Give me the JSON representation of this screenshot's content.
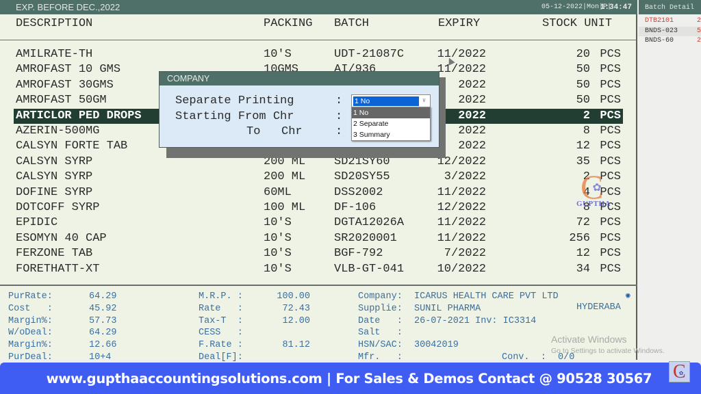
{
  "window": {
    "title": "EXP. BEFORE DEC.,2022",
    "datetime": "05-12-2022|Mon|P|",
    "clock": "1:34:47"
  },
  "columns": {
    "description": "DESCRIPTION",
    "packing": "PACKING",
    "batch": "BATCH",
    "expiry": "EXPIRY",
    "stock_unit": "STOCK UNIT"
  },
  "rows": [
    {
      "description": "AMILRATE-TH",
      "packing": "10'S",
      "batch": "UDT-21087C",
      "expiry": "11/2022",
      "stock": "20",
      "unit": "PCS"
    },
    {
      "description": "AMROFAST 10 GMS",
      "packing": "10GMS",
      "batch": "AI/936",
      "expiry": "11/2022",
      "stock": "50",
      "unit": "PCS"
    },
    {
      "description": "AMROFAST 30GMS",
      "packing": "",
      "batch": "",
      "expiry": "2022",
      "stock": "50",
      "unit": "PCS"
    },
    {
      "description": "AMROFAST 50GM",
      "packing": "",
      "batch": "",
      "expiry": "2022",
      "stock": "50",
      "unit": "PCS"
    },
    {
      "description": "ARTICLOR PED DROPS",
      "packing": "",
      "batch": "",
      "expiry": "2022",
      "stock": "2",
      "unit": "PCS",
      "selected": true
    },
    {
      "description": "AZERIN-500MG",
      "packing": "",
      "batch": "",
      "expiry": "2022",
      "stock": "8",
      "unit": "PCS"
    },
    {
      "description": "CALSYN FORTE TAB",
      "packing": "",
      "batch": "",
      "expiry": "2022",
      "stock": "12",
      "unit": "PCS"
    },
    {
      "description": "CALSYN SYRP",
      "packing": "200 ML",
      "batch": "SD21SY60",
      "expiry": "12/2022",
      "stock": "35",
      "unit": "PCS"
    },
    {
      "description": "CALSYN SYRP",
      "packing": "200 ML",
      "batch": "SD20SY55",
      "expiry": "3/2022",
      "stock": "2",
      "unit": "PCS"
    },
    {
      "description": "DOFINE SYRP",
      "packing": "60ML",
      "batch": "DSS2002",
      "expiry": "11/2022",
      "stock": "4",
      "unit": "PCS"
    },
    {
      "description": "DOTCOFF SYRP",
      "packing": "100 ML",
      "batch": "DF-106",
      "expiry": "12/2022",
      "stock": "8",
      "unit": "PCS"
    },
    {
      "description": "EPIDIC",
      "packing": "10'S",
      "batch": "DGTA12026A",
      "expiry": "11/2022",
      "stock": "72",
      "unit": "PCS"
    },
    {
      "description": "ESOMYN 40 CAP",
      "packing": "10'S",
      "batch": "SR2020001",
      "expiry": "11/2022",
      "stock": "256",
      "unit": "PCS"
    },
    {
      "description": "FERZONE TAB",
      "packing": "10'S",
      "batch": "BGF-792",
      "expiry": "7/2022",
      "stock": "12",
      "unit": "PCS"
    },
    {
      "description": "FORETHATT-XT",
      "packing": "10'S",
      "batch": "VLB-GT-041",
      "expiry": "10/2022",
      "stock": "34",
      "unit": "PCS"
    }
  ],
  "info": {
    "left": [
      {
        "label": "PurRate:",
        "value": "64.29"
      },
      {
        "label": "Cost   :",
        "value": "45.92"
      },
      {
        "label": "Margin%:",
        "value": "57.73"
      },
      {
        "label": "W/oDeal:",
        "value": "64.29"
      },
      {
        "label": "Margin%:",
        "value": "12.66"
      },
      {
        "label": "PurDeal:",
        "value": "10+4"
      }
    ],
    "middle": [
      {
        "label": "M.R.P. :",
        "value": "100.00"
      },
      {
        "label": "Rate   :",
        "value": "72.43"
      },
      {
        "label": "Tax-T  :",
        "value": "12.00"
      },
      {
        "label": "CESS   :",
        "value": ""
      },
      {
        "label": "F.Rate :",
        "value": "81.12"
      },
      {
        "label": "Deal[F]:",
        "value": ""
      }
    ],
    "right": [
      {
        "label": "Company:",
        "value": "ICARUS HEALTH CARE PVT LTD"
      },
      {
        "label": "Supplie:",
        "value": "SUNIL PHARMA"
      },
      {
        "label": "Date   :",
        "value": "26-07-2021 Inv: IC3314"
      },
      {
        "label": "Salt   :",
        "value": ""
      },
      {
        "label": "HSN/SAC:",
        "value": "30042019"
      },
      {
        "label": "Mfr.   :",
        "value": ""
      }
    ],
    "supplier_city": "HYDERABA",
    "conv_label": "Conv.  :",
    "conv_value": "0/0"
  },
  "batch_panel": {
    "title": "Batch Detail",
    "items": [
      {
        "batch": "DTB2101",
        "tail": "2"
      },
      {
        "batch": "BNDS-023",
        "tail": "5"
      },
      {
        "batch": "BNDS-60",
        "tail": "2"
      }
    ]
  },
  "dialog": {
    "title": "COMPANY",
    "label_separate": "Separate Printing",
    "label_from": "Starting From Chr",
    "label_to": "To   Chr",
    "colon": ":",
    "selected": "1 No",
    "options": [
      "1 No",
      "2 Separate",
      "3 Summary"
    ]
  },
  "watermark": {
    "brand": "GUPTHA",
    "activate_title": "Activate Windows",
    "activate_sub": "Go to Settings to activate Windows."
  },
  "footer": {
    "text": "www.gupthaaccountingsolutions.com | For Sales & Demos Contact @ 90528 30567"
  }
}
